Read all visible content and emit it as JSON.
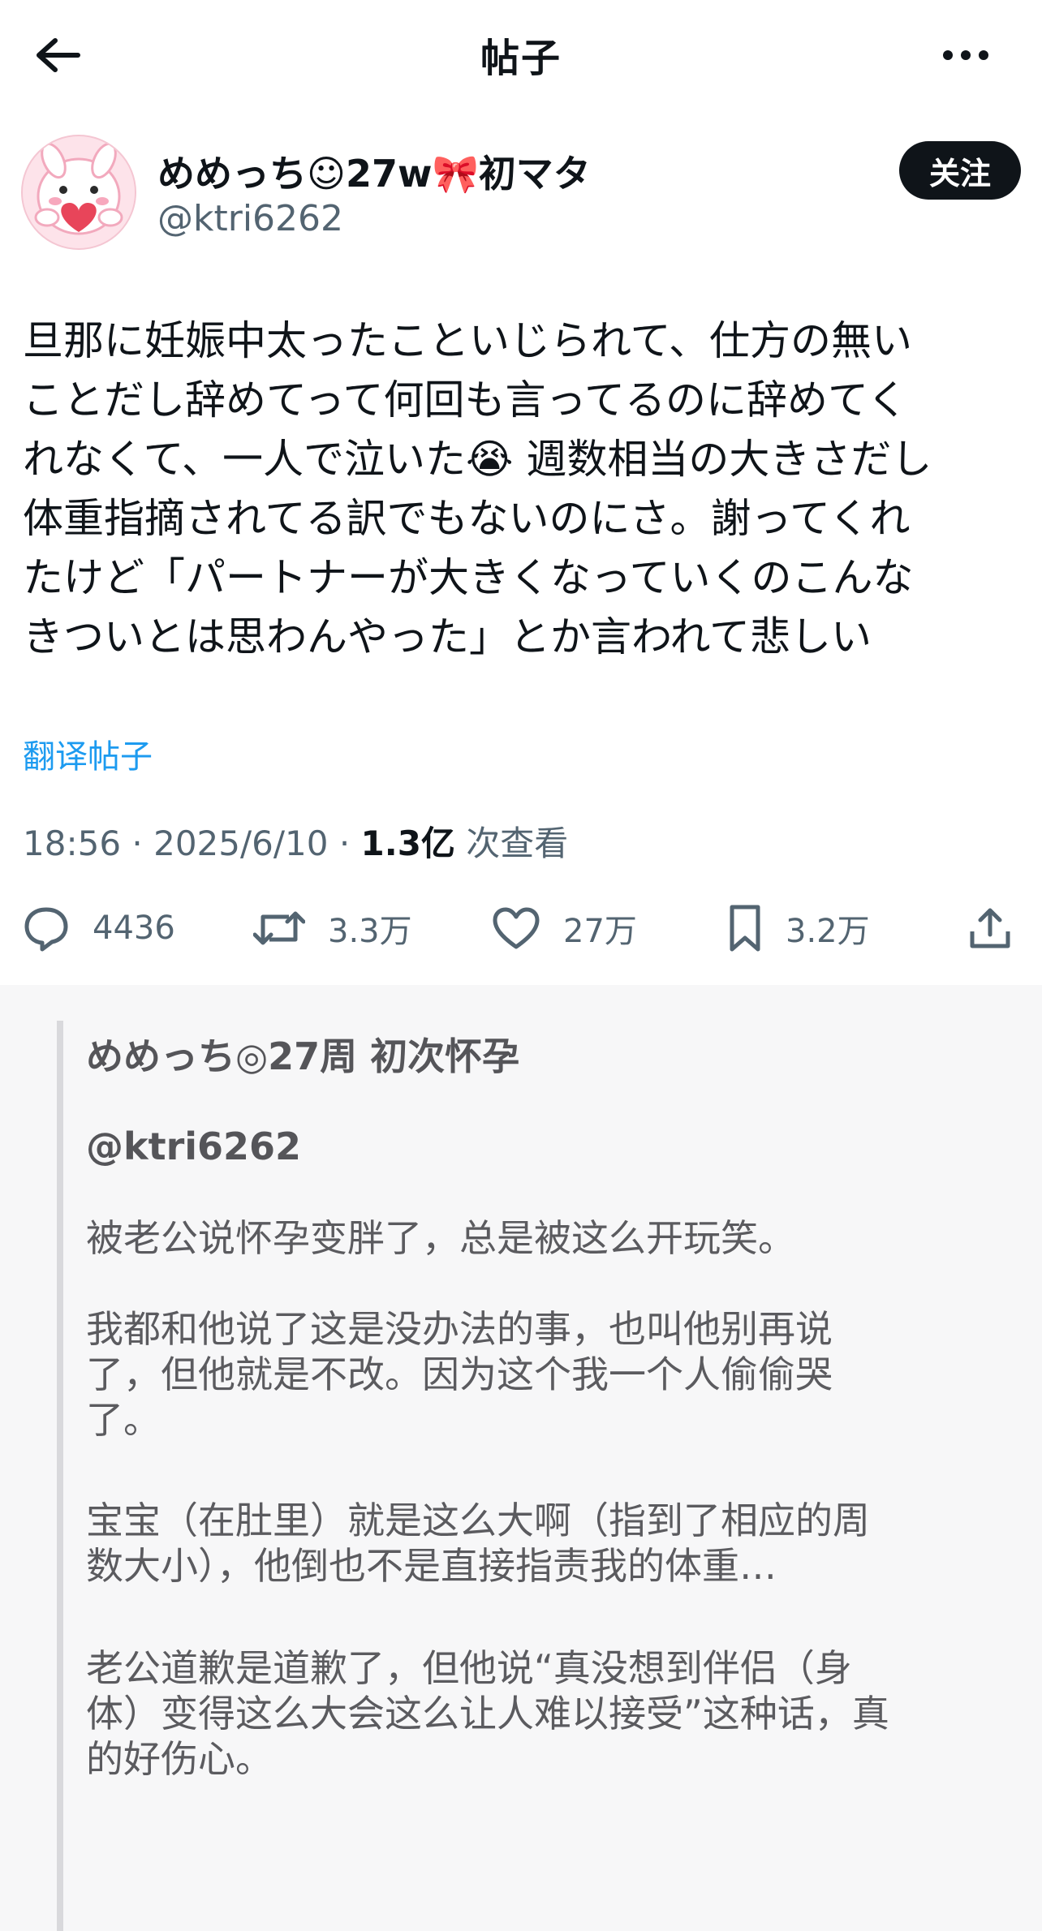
{
  "header": {
    "title": "帖子",
    "back_icon": "arrow-left-icon",
    "more_icon": "more-dots-icon"
  },
  "author": {
    "display_name": "めめっち☺27w🎀初マタ",
    "handle": "@ktri6262",
    "follow_label": "关注",
    "avatar_icon": "pink-bunny-heart-avatar"
  },
  "post": {
    "lines": [
      "旦那に妊娠中太ったこといじられて、仕方の無い",
      "ことだし辞めてって何回も言ってるのに辞めてく",
      "れなくて、一人で泣いた😭 週数相当の大きさだし",
      "体重指摘されてる訳でもないのにさ。謝ってくれ",
      "たけど「パートナーが大きくなっていくのこんな",
      "きついとは思わんやった」とか言われて悲しい"
    ],
    "translate_label": "翻译帖子"
  },
  "meta": {
    "time": "18:56",
    "date": "2025/6/10",
    "views_count": "1.3亿",
    "views_label": "次查看",
    "sep": " · "
  },
  "actions": {
    "reply_count": "4436",
    "repost_count": "3.3万",
    "like_count": "27万",
    "bookmark_count": "3.2万"
  },
  "translation": {
    "name": "めめっち◎27周 初次怀孕",
    "handle": "@ktri6262",
    "paragraphs": [
      [
        "被老公说怀孕变胖了，总是被这么开玩笑。"
      ],
      [
        "我都和他说了这是没办法的事，也叫他别再说",
        "了，但他就是不改。因为这个我一个人偷偷哭",
        "了。"
      ],
      [
        "宝宝（在肚里）就是这么大啊（指到了相应的周",
        "数大小），他倒也不是直接指责我的体重…"
      ],
      [
        "老公道歉是道歉了，但他说“真没想到伴侣（身",
        "体）变得这么大会这么让人难以接受”这种话，真",
        "的好伤心。"
      ]
    ]
  },
  "colors": {
    "accent": "#1d9bf0",
    "text": "#0f1419",
    "muted": "#536471",
    "translation_bg": "#f7f7f8"
  }
}
